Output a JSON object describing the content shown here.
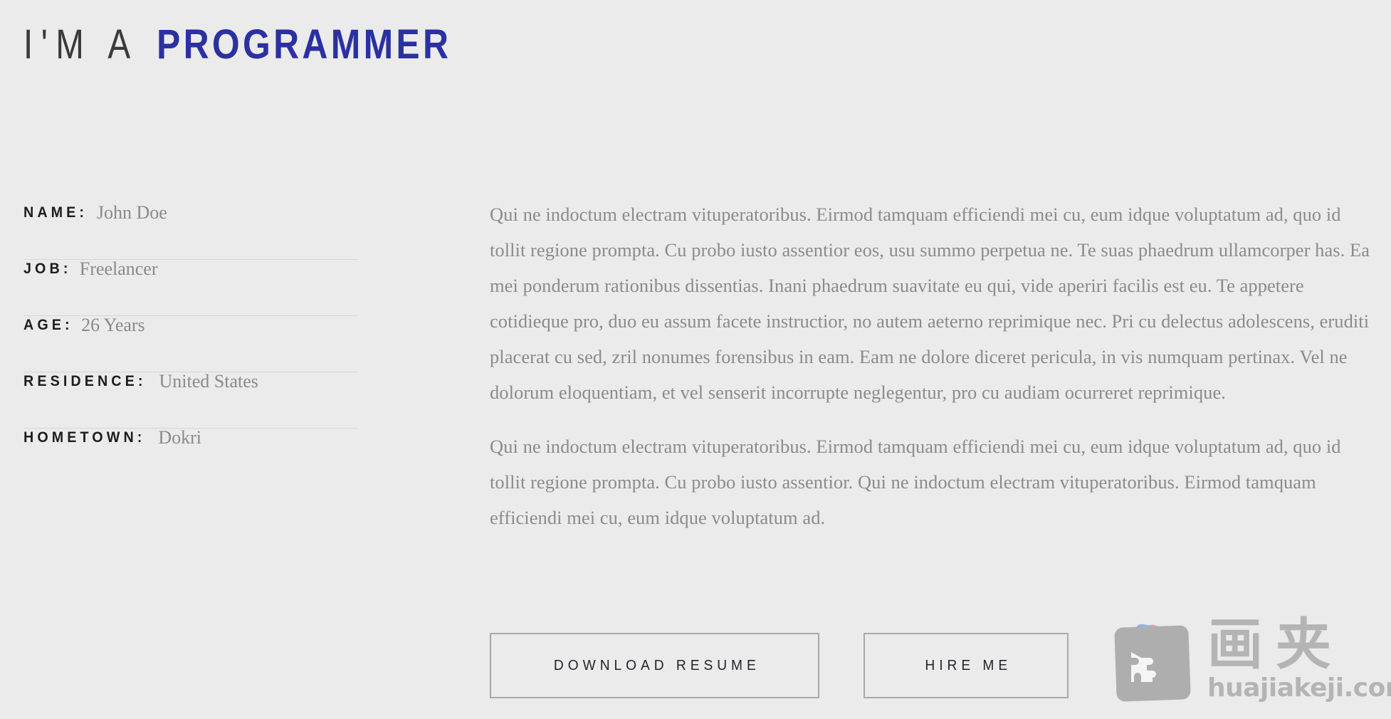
{
  "theme": {
    "background": "#ebebeb",
    "accent_blue": "#2b31a0",
    "label_color": "#1d1d1d",
    "value_color": "#8a8a8a",
    "body_color": "#8b8b8e",
    "divider_color": "#d6d6d6",
    "button_border": "#a9a9a9",
    "watermark_color": "#b4b4b4"
  },
  "headline": {
    "prefix": "I'M A",
    "highlight": "PROGRAMMER"
  },
  "info": {
    "rows": [
      {
        "label": "NAME:",
        "value": "John Doe"
      },
      {
        "label": "JOB:",
        "value": "Freelancer"
      },
      {
        "label": "AGE:",
        "value": "26 Years"
      },
      {
        "label": "RESIDENCE:",
        "value": "United States"
      },
      {
        "label": "HOMETOWN:",
        "value": "Dokri"
      }
    ]
  },
  "content": {
    "paragraphs": [
      "Qui ne indoctum electram vituperatoribus. Eirmod tamquam efficiendi mei cu, eum idque voluptatum ad, quo id tollit regione prompta. Cu probo iusto assentior eos, usu summo perpetua ne. Te suas phaedrum ullamcorper has. Ea mei ponderum rationibus dissentias. Inani phaedrum suavitate eu qui, vide aperiri facilis est eu. Te appetere cotidieque pro, duo eu assum facete instructior, no autem aeterno reprimique nec. Pri cu delectus adolescens, eruditi placerat cu sed, zril nonumes forensibus in eam. Eam ne dolore diceret pericula, in vis numquam pertinax. Vel ne dolorum eloquentiam, et vel senserit incorrupte neglegentur, pro cu audiam ocurreret reprimique.",
      "Qui ne indoctum electram vituperatoribus. Eirmod tamquam efficiendi mei cu, eum idque voluptatum ad, quo id tollit regione prompta. Cu probo iusto assentior. Qui ne indoctum electram vituperatoribus. Eirmod tamquam efficiendi mei cu, eum idque voluptatum ad."
    ]
  },
  "actions": {
    "download_resume": "DOWNLOAD RESUME",
    "hire_me": "HIRE ME"
  },
  "watermark": {
    "glyph_1": "画",
    "glyph_2": "夹",
    "domain": "huajiakeji.com",
    "icon_name": "stacked-cards-puzzle-icon"
  }
}
